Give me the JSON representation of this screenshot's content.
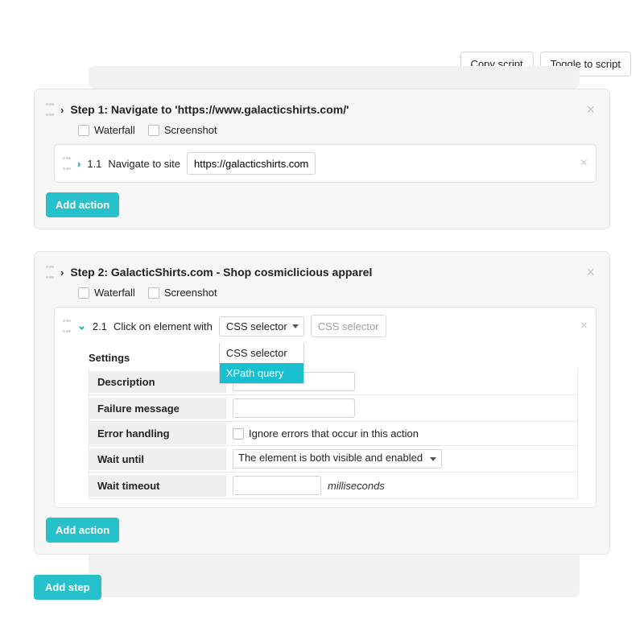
{
  "toolbar": {
    "copy_script": "Copy script",
    "toggle_script": "Toggle to script"
  },
  "step1": {
    "title": "Step 1: Navigate to 'https://www.galacticshirts.com/'",
    "waterfall_label": "Waterfall",
    "screenshot_label": "Screenshot",
    "action": {
      "index": "1.1",
      "label": "Navigate to site",
      "url": "https://galacticshirts.com"
    },
    "add_action": "Add action"
  },
  "step2": {
    "title": "Step 2: GalacticShirts.com - Shop cosmiclicious apparel",
    "waterfall_label": "Waterfall",
    "screenshot_label": "Screenshot",
    "action": {
      "index": "2.1",
      "label": "Click on element with",
      "selector_type": {
        "value": "CSS selector",
        "options": [
          "CSS selector",
          "XPath query"
        ],
        "highlighted": "XPath query"
      },
      "selector_placeholder": "CSS selector"
    },
    "settings": {
      "title": "Settings",
      "description_label": "Description",
      "failure_label": "Failure message",
      "error_handling_label": "Error handling",
      "error_checkbox": "Ignore errors that occur in this action",
      "wait_until_label": "Wait until",
      "wait_until_value": "The element is both visible and enabled",
      "wait_timeout_label": "Wait timeout",
      "wait_timeout_unit": "milliseconds"
    },
    "add_action": "Add action"
  },
  "add_step": "Add step"
}
